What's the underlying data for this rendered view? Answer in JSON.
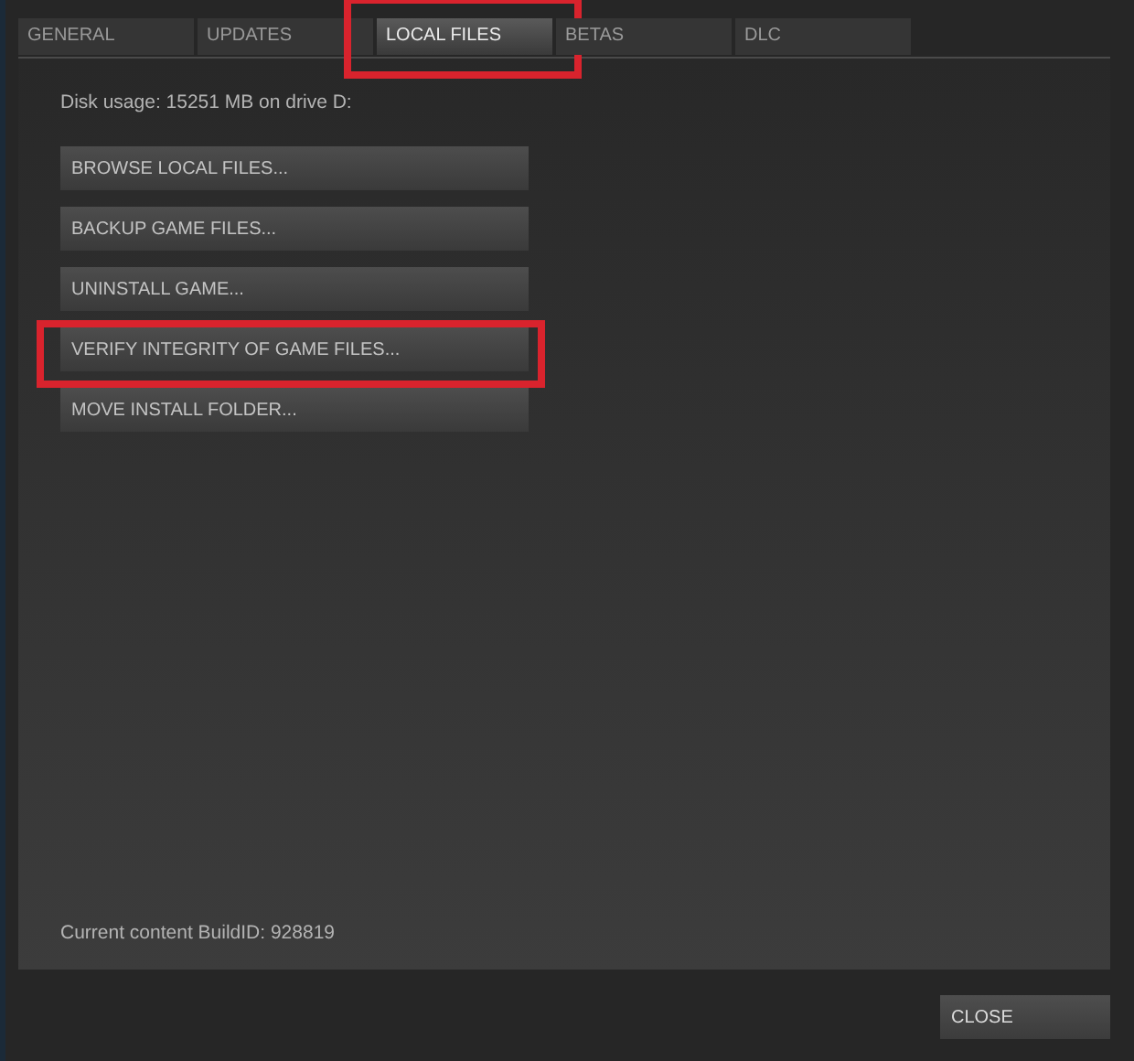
{
  "tabs": [
    {
      "label": "GENERAL",
      "selected": false,
      "highlighted": false
    },
    {
      "label": "UPDATES",
      "selected": false,
      "highlighted": false
    },
    {
      "label": "LOCAL FILES",
      "selected": true,
      "highlighted": true
    },
    {
      "label": "BETAS",
      "selected": false,
      "highlighted": false
    },
    {
      "label": "DLC",
      "selected": false,
      "highlighted": false
    }
  ],
  "disk_usage": "Disk usage: 15251 MB on drive D:",
  "buttons": [
    {
      "label": "BROWSE LOCAL FILES...",
      "highlighted": false
    },
    {
      "label": "BACKUP GAME FILES...",
      "highlighted": false
    },
    {
      "label": "UNINSTALL GAME...",
      "highlighted": false
    },
    {
      "label": "VERIFY INTEGRITY OF GAME FILES...",
      "highlighted": true
    },
    {
      "label": "MOVE INSTALL FOLDER...",
      "highlighted": false
    }
  ],
  "build_id": "Current content BuildID: 928819",
  "close_button": "CLOSE"
}
